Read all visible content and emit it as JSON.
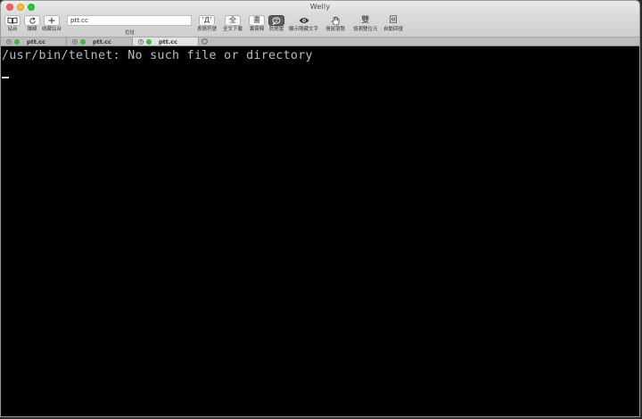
{
  "window": {
    "title": "Welly"
  },
  "toolbar": {
    "sites": {
      "icon": "book-icon",
      "label": "站台"
    },
    "reconnect": {
      "icon": "refresh-icon",
      "label": "讓線"
    },
    "add_site": {
      "icon": "plus-icon",
      "label": "收藏站台"
    },
    "address": {
      "value": "ptt.cc",
      "label": "位址"
    },
    "emoticons": {
      "icon": "emoticon-icon",
      "glyph": "'Д'",
      "label": "表情符號"
    },
    "download": {
      "glyph": "全",
      "label": "全文下載"
    },
    "bookmarks": {
      "glyph": "書",
      "label": "書簽欄"
    },
    "anti_idle": {
      "icon": "anti-idle-icon",
      "label": "防閒置"
    },
    "show_hidden": {
      "icon": "eye-icon",
      "label": "顯示隱藏文字"
    },
    "mouse_browse": {
      "icon": "hand-icon",
      "label": "滑鼠瀏覽"
    },
    "double_byte": {
      "glyph": "雙",
      "label": "偵測雙位元"
    },
    "auto_reply": {
      "glyph": "回",
      "label": "自動回復"
    }
  },
  "tabs": [
    {
      "title": "ptt.cc",
      "active": false
    },
    {
      "title": "ptt.cc",
      "active": false
    },
    {
      "title": "ptt.cc",
      "active": true
    }
  ],
  "terminal": {
    "line1": "/usr/bin/telnet: No such file or directory"
  }
}
